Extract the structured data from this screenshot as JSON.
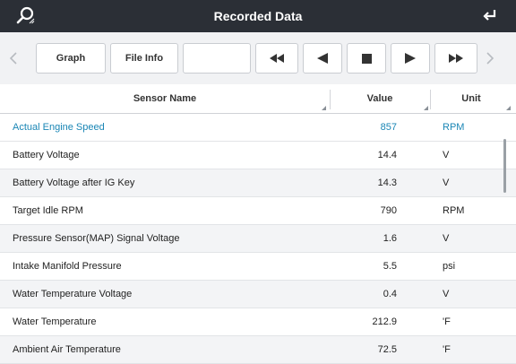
{
  "window": {
    "title": "Recorded Data"
  },
  "titlebar": {
    "left_icon": "search-icon",
    "right_icon": "back-arrow-icon"
  },
  "toolbar": {
    "graph_label": "Graph",
    "file_info_label": "File Info",
    "blank_label": "",
    "prev_chevron_icon": "chevron-left-icon",
    "next_chevron_icon": "chevron-right-icon",
    "rewind_icon": "rewind-icon",
    "step_back_icon": "step-back-icon",
    "stop_icon": "stop-icon",
    "play_icon": "play-icon",
    "fast_forward_icon": "fast-forward-icon"
  },
  "table": {
    "headers": {
      "name": "Sensor Name",
      "value": "Value",
      "unit": "Unit"
    },
    "selected_color": "#1a86b5",
    "rows": [
      {
        "name": "Actual Engine Speed",
        "value": "857",
        "unit": "RPM"
      },
      {
        "name": "Battery Voltage",
        "value": "14.4",
        "unit": "V"
      },
      {
        "name": "Battery Voltage after IG Key",
        "value": "14.3",
        "unit": "V"
      },
      {
        "name": "Target Idle RPM",
        "value": "790",
        "unit": "RPM"
      },
      {
        "name": "Pressure Sensor(MAP) Signal Voltage",
        "value": "1.6",
        "unit": "V"
      },
      {
        "name": "Intake Manifold Pressure",
        "value": "5.5",
        "unit": "psi"
      },
      {
        "name": "Water Temperature Voltage",
        "value": "0.4",
        "unit": "V"
      },
      {
        "name": "Water Temperature",
        "value": "212.9",
        "unit": "'F"
      },
      {
        "name": "Ambient Air Temperature",
        "value": "72.5",
        "unit": "'F"
      }
    ]
  }
}
